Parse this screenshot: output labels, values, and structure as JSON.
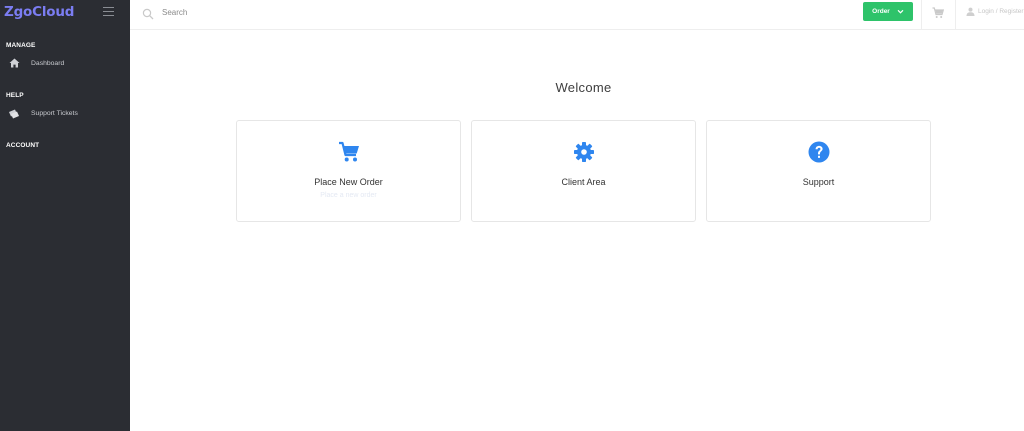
{
  "app": {
    "brand": "ZgoCloud"
  },
  "sidebar": {
    "sections": [
      {
        "title": "MANAGE",
        "items": [
          {
            "label": "Dashboard",
            "icon": "home-icon"
          }
        ]
      },
      {
        "title": "HELP",
        "items": [
          {
            "label": "Support Tickets",
            "icon": "tickets-icon"
          }
        ]
      },
      {
        "title": "ACCOUNT",
        "items": []
      }
    ]
  },
  "topbar": {
    "search": {
      "placeholder": "Search",
      "value": ""
    },
    "order_label": "Order",
    "login_label": "Login / Register",
    "cart_icon": "cart-icon"
  },
  "main": {
    "welcome": "Welcome",
    "cards": [
      {
        "title": "Place New Order",
        "subtitle": "Place a new order",
        "icon": "cart-icon"
      },
      {
        "title": "Client Area",
        "subtitle": "",
        "icon": "gear-icon"
      },
      {
        "title": "Support",
        "subtitle": "",
        "icon": "question-circle-icon"
      }
    ]
  },
  "colors": {
    "sidebar_bg": "#2b2d33",
    "brand": "#7b7df2",
    "accent_blue": "#2f86ef",
    "order_green": "#2ec36a"
  }
}
